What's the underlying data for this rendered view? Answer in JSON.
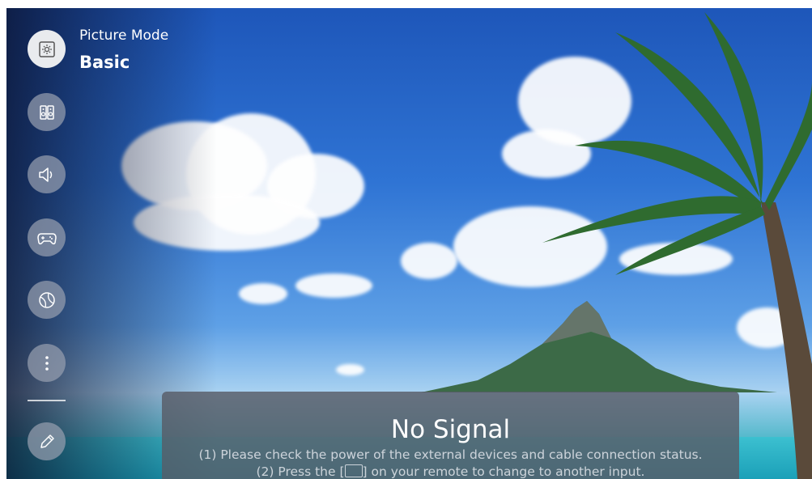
{
  "picture_mode": {
    "title": "Picture Mode",
    "value": "Basic"
  },
  "sidebar": {
    "items": [
      {
        "name": "picture-mode",
        "icon": "brightness-icon"
      },
      {
        "name": "sound-mode",
        "icon": "speakers-icon"
      },
      {
        "name": "sound-output",
        "icon": "volume-icon"
      },
      {
        "name": "game",
        "icon": "gamepad-icon"
      },
      {
        "name": "sports",
        "icon": "ball-icon"
      },
      {
        "name": "more",
        "icon": "more-vertical-icon"
      },
      {
        "name": "edit",
        "icon": "pencil-icon"
      }
    ]
  },
  "no_signal": {
    "title": "No Signal",
    "line1": "(1) Please check the power of the external devices and cable connection status.",
    "line2_prefix": "(2) Press the [",
    "line2_suffix": "] on your remote to change to another input."
  }
}
